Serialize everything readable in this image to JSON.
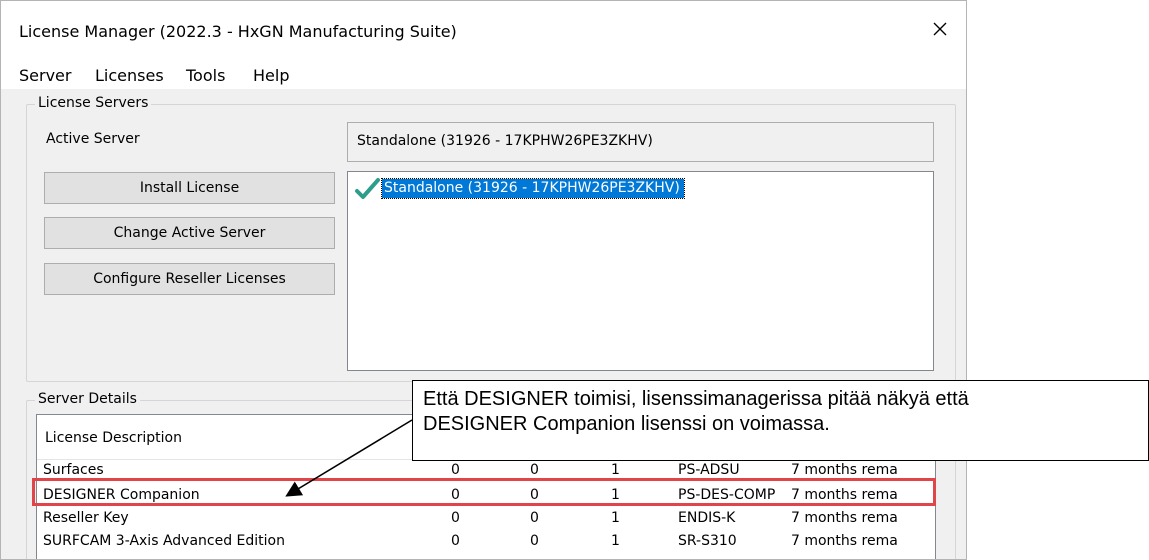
{
  "window": {
    "title": "License Manager (2022.3 - HxGN Manufacturing Suite)"
  },
  "menu": [
    "Server",
    "Licenses",
    "Tools",
    "Help"
  ],
  "license_servers": {
    "group_label": "License Servers",
    "active_server_label": "Active Server",
    "active_server_value": "Standalone (31926 - 17KPHW26PE3ZKHV)",
    "buttons": {
      "install": "Install License",
      "change": "Change Active Server",
      "configure": "Configure Reseller Licenses"
    },
    "server_list": [
      {
        "label": "Standalone (31926 - 17KPHW26PE3ZKHV)",
        "selected": true,
        "icon": "check-icon"
      }
    ]
  },
  "server_details": {
    "group_label": "Server Details",
    "header_description": "License Description",
    "rows": [
      {
        "description": "Surfaces",
        "c1": "0",
        "c2": "0",
        "c3": "1",
        "code": "PS-ADSU",
        "remaining": "7 months rema"
      },
      {
        "description": "DESIGNER Companion",
        "c1": "0",
        "c2": "0",
        "c3": "1",
        "code": "PS-DES-COMP",
        "remaining": "7 months rema"
      },
      {
        "description": "Reseller Key",
        "c1": "0",
        "c2": "0",
        "c3": "1",
        "code": "ENDIS-K",
        "remaining": "7 months rema"
      },
      {
        "description": "SURFCAM 3-Axis Advanced Edition",
        "c1": "0",
        "c2": "0",
        "c3": "1",
        "code": "SR-S310",
        "remaining": "7 months rema"
      }
    ]
  },
  "annotation": {
    "line1": "Että DESIGNER toimisi, lisenssimanagerissa pitää näkyä että",
    "line2": "DESIGNER Companion lisenssi on voimassa.",
    "highlight_color": "#e0454a"
  },
  "colors": {
    "selection": "#0078d7",
    "check": "#2e9e8c"
  }
}
